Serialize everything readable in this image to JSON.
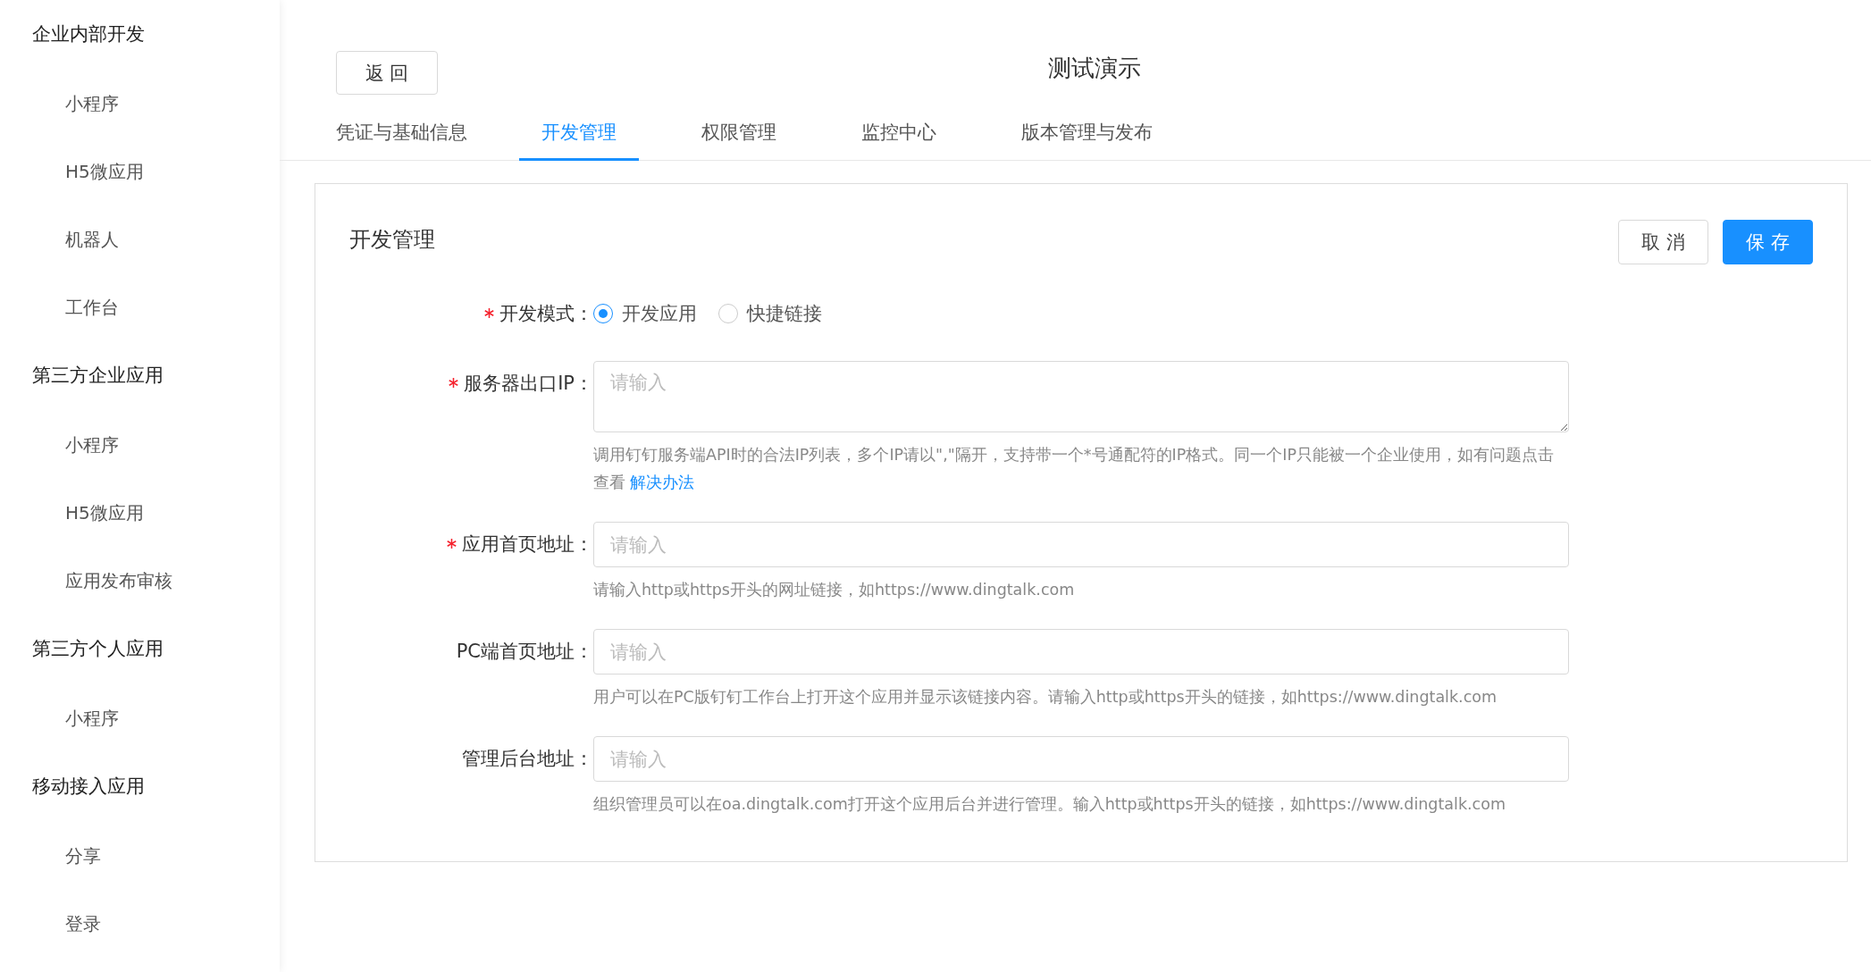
{
  "sidebar": {
    "groups": [
      {
        "label": "企业内部开发",
        "items": [
          {
            "label": "小程序"
          },
          {
            "label": "H5微应用"
          },
          {
            "label": "机器人"
          },
          {
            "label": "工作台"
          }
        ]
      },
      {
        "label": "第三方企业应用",
        "items": [
          {
            "label": "小程序"
          },
          {
            "label": "H5微应用"
          },
          {
            "label": "应用发布审核"
          }
        ]
      },
      {
        "label": "第三方个人应用",
        "items": [
          {
            "label": "小程序"
          }
        ]
      },
      {
        "label": "移动接入应用",
        "items": [
          {
            "label": "分享"
          },
          {
            "label": "登录"
          }
        ]
      }
    ]
  },
  "header": {
    "back_button": "返 回",
    "title": "测试演示"
  },
  "tabs": [
    {
      "label": "凭证与基础信息",
      "selected": false
    },
    {
      "label": "开发管理",
      "selected": true
    },
    {
      "label": "权限管理",
      "selected": false
    },
    {
      "label": "监控中心",
      "selected": false
    },
    {
      "label": "版本管理与发布",
      "selected": false
    }
  ],
  "card": {
    "title": "开发管理",
    "buttons": [
      {
        "label": "取 消",
        "kind": "default"
      },
      {
        "label": "保 存",
        "kind": "primary"
      }
    ],
    "fields": [
      {
        "kind": "radio",
        "label": "开发模式：",
        "required": true,
        "options": [
          {
            "label": "开发应用",
            "selected": true
          },
          {
            "label": "快捷链接",
            "selected": false
          }
        ]
      },
      {
        "kind": "textarea",
        "label": "服务器出口IP：",
        "required": true,
        "placeholder": "请输入",
        "hint": "调用钉钉服务端API时的合法IP列表，多个IP请以\",\"隔开，支持带一个*号通配符的IP格式。同一个IP只能被一个企业使用，如有问题点击查看",
        "hint_link": "解决办法"
      },
      {
        "kind": "input",
        "label": "应用首页地址：",
        "required": true,
        "placeholder": "请输入",
        "hint": "请输入http或https开头的网址链接，如https://www.dingtalk.com"
      },
      {
        "kind": "input",
        "label": "PC端首页地址：",
        "required": false,
        "placeholder": "请输入",
        "hint": "用户可以在PC版钉钉工作台上打开这个应用并显示该链接内容。请输入http或https开头的链接，如https://www.dingtalk.com"
      },
      {
        "kind": "input",
        "label": "管理后台地址：",
        "required": false,
        "placeholder": "请输入",
        "hint": "组织管理员可以在oa.dingtalk.com打开这个应用后台并进行管理。输入http或https开头的链接，如https://www.dingtalk.com"
      }
    ]
  }
}
